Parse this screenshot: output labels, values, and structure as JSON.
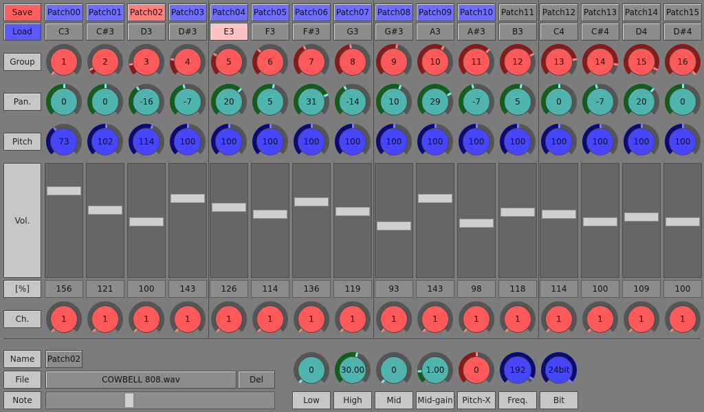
{
  "side": {
    "save": "Save",
    "load": "Load",
    "group": "Group",
    "pan": "Pan.",
    "pitch": "Pitch",
    "vol": "Vol.",
    "percent": "[%]",
    "ch": "Ch."
  },
  "patches": [
    {
      "name": "Patch00",
      "note": "C3",
      "group": "1",
      "pan": "0",
      "pitch": "73",
      "vol": "156",
      "ch": "1"
    },
    {
      "name": "Patch01",
      "note": "C#3",
      "group": "2",
      "pan": "0",
      "pitch": "102",
      "vol": "121",
      "ch": "1"
    },
    {
      "name": "Patch02",
      "note": "D3",
      "group": "3",
      "pan": "-16",
      "pitch": "114",
      "vol": "100",
      "ch": "1"
    },
    {
      "name": "Patch03",
      "note": "D#3",
      "group": "4",
      "pan": "-7",
      "pitch": "100",
      "vol": "143",
      "ch": "1"
    },
    {
      "name": "Patch04",
      "note": "E3",
      "group": "5",
      "pan": "20",
      "pitch": "100",
      "vol": "126",
      "ch": "1"
    },
    {
      "name": "Patch05",
      "note": "F3",
      "group": "6",
      "pan": "5",
      "pitch": "100",
      "vol": "114",
      "ch": "1"
    },
    {
      "name": "Patch06",
      "note": "F#3",
      "group": "7",
      "pan": "31",
      "pitch": "100",
      "vol": "136",
      "ch": "1"
    },
    {
      "name": "Patch07",
      "note": "G3",
      "group": "8",
      "pan": "-14",
      "pitch": "100",
      "vol": "119",
      "ch": "1"
    },
    {
      "name": "Patch08",
      "note": "G#3",
      "group": "9",
      "pan": "10",
      "pitch": "100",
      "vol": "93",
      "ch": "1"
    },
    {
      "name": "Patch09",
      "note": "A3",
      "group": "10",
      "pan": "29",
      "pitch": "100",
      "vol": "143",
      "ch": "1"
    },
    {
      "name": "Patch10",
      "note": "A#3",
      "group": "11",
      "pan": "-7",
      "pitch": "100",
      "vol": "98",
      "ch": "1"
    },
    {
      "name": "Patch11",
      "note": "B3",
      "group": "12",
      "pan": "5",
      "pitch": "100",
      "vol": "118",
      "ch": "1"
    },
    {
      "name": "Patch12",
      "note": "C4",
      "group": "13",
      "pan": "0",
      "pitch": "100",
      "vol": "114",
      "ch": "1"
    },
    {
      "name": "Patch13",
      "note": "C#4",
      "group": "14",
      "pan": "-7",
      "pitch": "100",
      "vol": "100",
      "ch": "1"
    },
    {
      "name": "Patch14",
      "note": "D4",
      "group": "15",
      "pan": "20",
      "pitch": "100",
      "vol": "109",
      "ch": "1"
    },
    {
      "name": "Patch15",
      "note": "D#4",
      "group": "16",
      "pan": "0",
      "pitch": "100",
      "vol": "100",
      "ch": "1"
    }
  ],
  "selected_patch_index": 2,
  "highlighted_note_index": 4,
  "unassigned_patch_indices": [
    11,
    12,
    13,
    14,
    15
  ],
  "detail": {
    "name_label": "Name",
    "name_value": "Patch02",
    "file_label": "File",
    "file_value": "COWBELL 808.wav",
    "del_label": "Del",
    "note_label": "Note",
    "note_slider_fraction": 0.36
  },
  "fx": [
    {
      "label": "Low",
      "value": "0",
      "color": "teal"
    },
    {
      "label": "High",
      "value": "30.00",
      "color": "teal"
    },
    {
      "label": "Mid",
      "value": "0",
      "color": "teal"
    },
    {
      "label": "Mid-gain",
      "value": "1.00",
      "color": "teal"
    },
    {
      "label": "Pitch-X",
      "value": "0",
      "color": "red"
    },
    {
      "label": "Freq.",
      "value": "192",
      "color": "blue"
    },
    {
      "label": "Bit",
      "value": "24bit",
      "color": "blue"
    }
  ],
  "colors": {
    "red_face": "#ff5a5a",
    "red_arc": "#8a1a1a",
    "red_ind": "#ff8080",
    "teal_face": "#4fb3ae",
    "teal_arc": "#0d5f1a",
    "teal_ind": "#7af0ee",
    "blue_face": "#4646ff",
    "blue_arc": "#0a0a7a",
    "blue_ind": "#7a7aff",
    "track": "#555555"
  }
}
